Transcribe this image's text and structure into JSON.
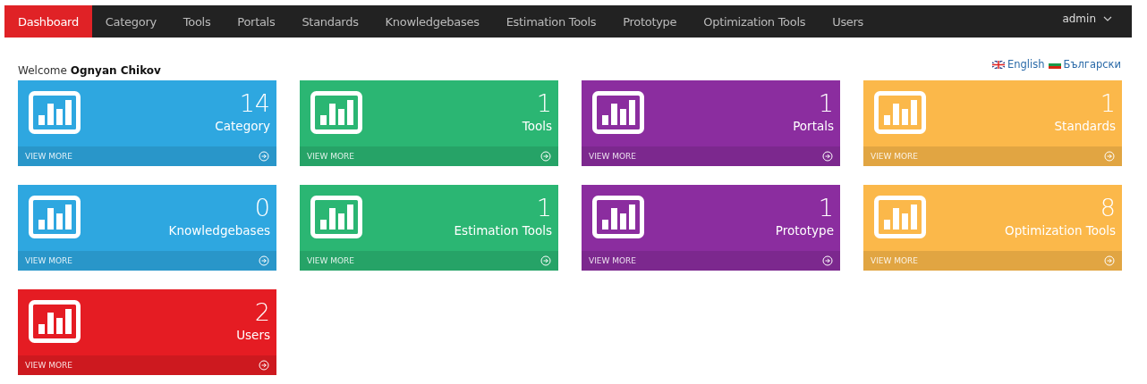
{
  "nav": {
    "items": [
      {
        "label": "Dashboard",
        "selected": true
      },
      {
        "label": "Category",
        "selected": false
      },
      {
        "label": "Tools",
        "selected": false
      },
      {
        "label": "Portals",
        "selected": false
      },
      {
        "label": "Standards",
        "selected": false
      },
      {
        "label": "Knowledgebases",
        "selected": false
      },
      {
        "label": "Estimation Tools",
        "selected": false
      },
      {
        "label": "Prototype",
        "selected": false
      },
      {
        "label": "Optimization Tools",
        "selected": false
      },
      {
        "label": "Users",
        "selected": false
      }
    ],
    "user": "admin"
  },
  "welcome": {
    "prefix": "Welcome",
    "name": "Ognyan Chikov"
  },
  "languages": [
    {
      "label": "English",
      "kind": "uk"
    },
    {
      "label": "Български",
      "kind": "bg"
    }
  ],
  "tiles": [
    {
      "count": "14",
      "label": "Category",
      "footer": "VIEW MORE",
      "color": "#2ea7e0"
    },
    {
      "count": "1",
      "label": "Tools",
      "footer": "VIEW MORE",
      "color": "#2bb673"
    },
    {
      "count": "1",
      "label": "Portals",
      "footer": "VIEW MORE",
      "color": "#8b2d9f"
    },
    {
      "count": "1",
      "label": "Standards",
      "footer": "VIEW MORE",
      "color": "#fbb84a"
    },
    {
      "count": "0",
      "label": "Knowledgebases",
      "footer": "VIEW MORE",
      "color": "#2ea7e0"
    },
    {
      "count": "1",
      "label": "Estimation Tools",
      "footer": "VIEW MORE",
      "color": "#2bb673"
    },
    {
      "count": "1",
      "label": "Prototype",
      "footer": "VIEW MORE",
      "color": "#8b2d9f"
    },
    {
      "count": "8",
      "label": "Optimization Tools",
      "footer": "VIEW MORE",
      "color": "#fbb84a"
    },
    {
      "count": "2",
      "label": "Users",
      "footer": "VIEW MORE",
      "color": "#e51c23"
    }
  ]
}
